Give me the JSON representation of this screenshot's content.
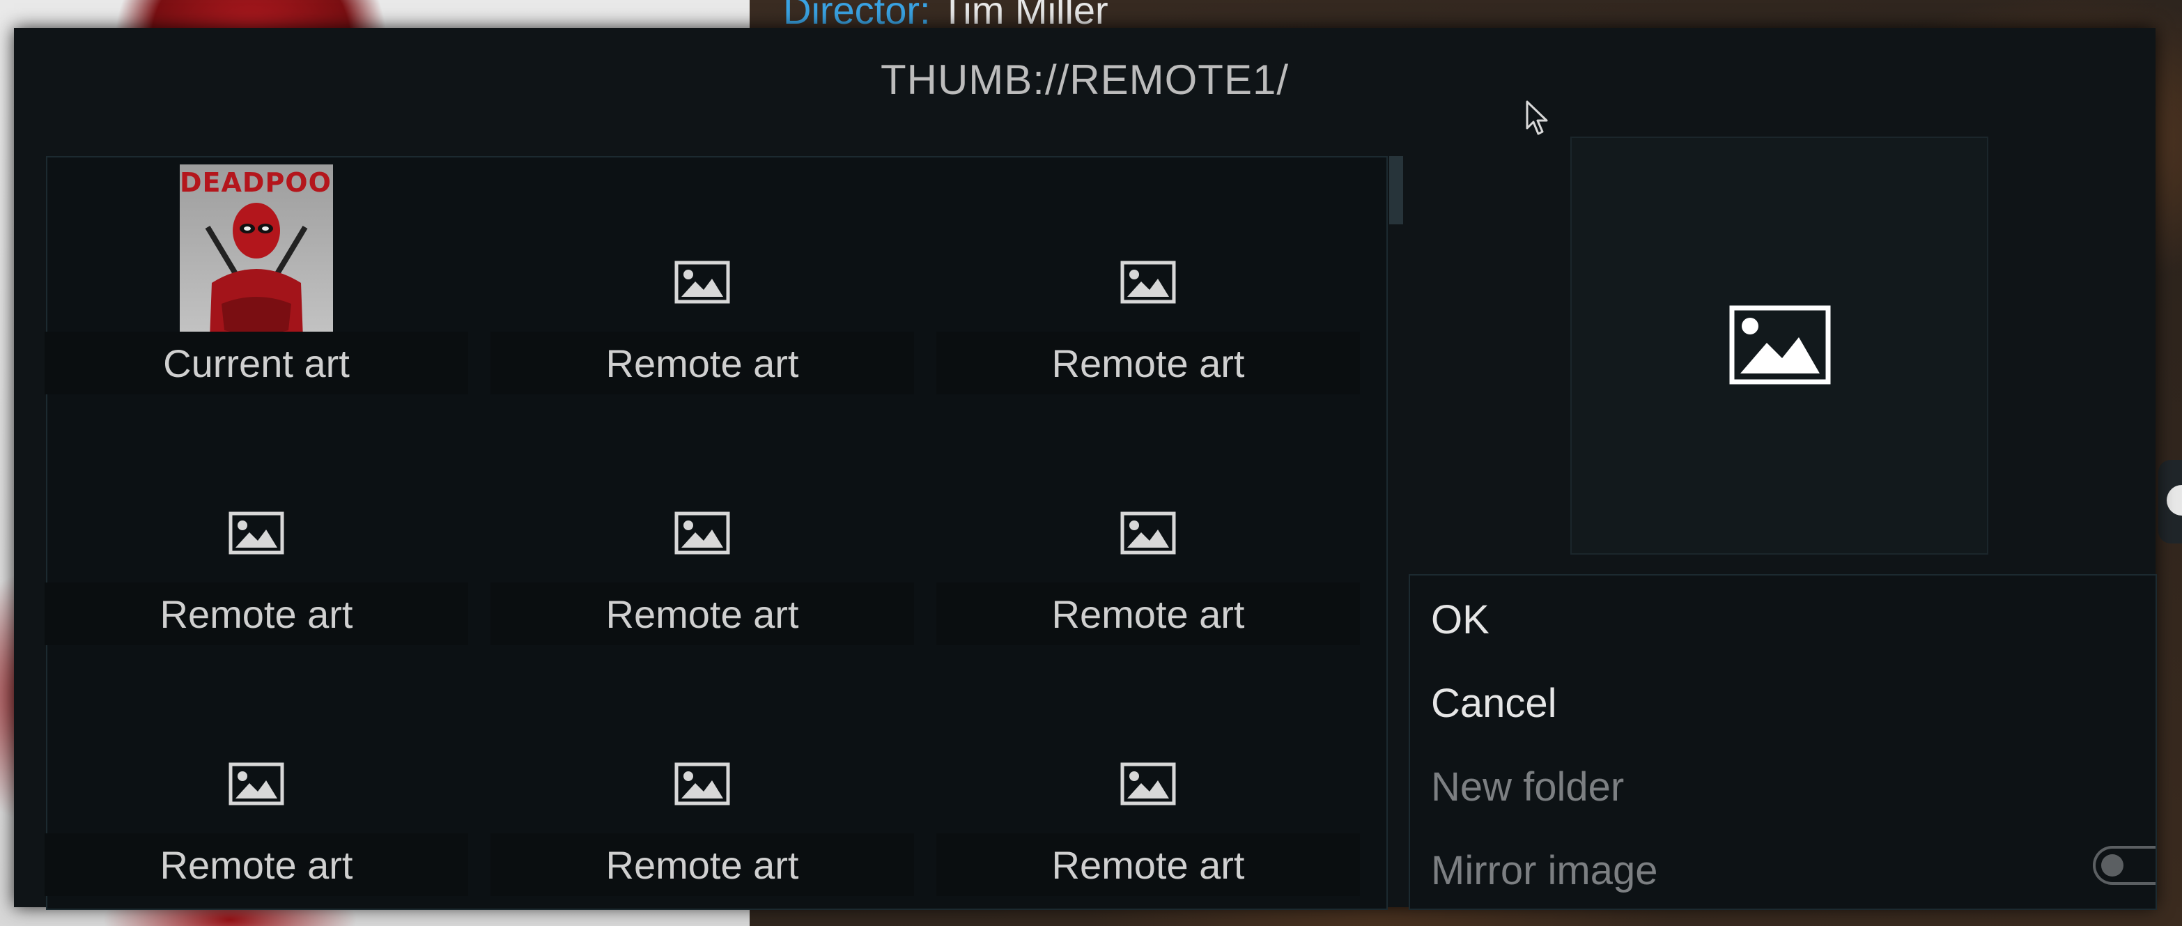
{
  "background": {
    "director_label": "Director:",
    "director_name": "Tim Miller"
  },
  "dialog": {
    "title": "THUMB://REMOTE1/",
    "tiles": [
      {
        "label": "Current art",
        "icon": "deadpool-poster"
      },
      {
        "label": "Remote art",
        "icon": "image-icon"
      },
      {
        "label": "Remote art",
        "icon": "image-icon"
      },
      {
        "label": "Remote art",
        "icon": "image-icon"
      },
      {
        "label": "Remote art",
        "icon": "image-icon"
      },
      {
        "label": "Remote art",
        "icon": "image-icon"
      },
      {
        "label": "Remote art",
        "icon": "image-icon"
      },
      {
        "label": "Remote art",
        "icon": "image-icon"
      },
      {
        "label": "Remote art",
        "icon": "image-icon"
      }
    ],
    "poster_title": "DEADPOOL",
    "buttons": {
      "ok": "OK",
      "cancel": "Cancel",
      "new_folder": "New folder",
      "mirror_image": "Mirror image"
    },
    "mirror_image_enabled": false
  },
  "colors": {
    "dialog_bg": "#0f1417",
    "label_text": "#d0d0d0",
    "disabled_text": "#7c7f82",
    "accent_blue": "#3aa3e3"
  }
}
